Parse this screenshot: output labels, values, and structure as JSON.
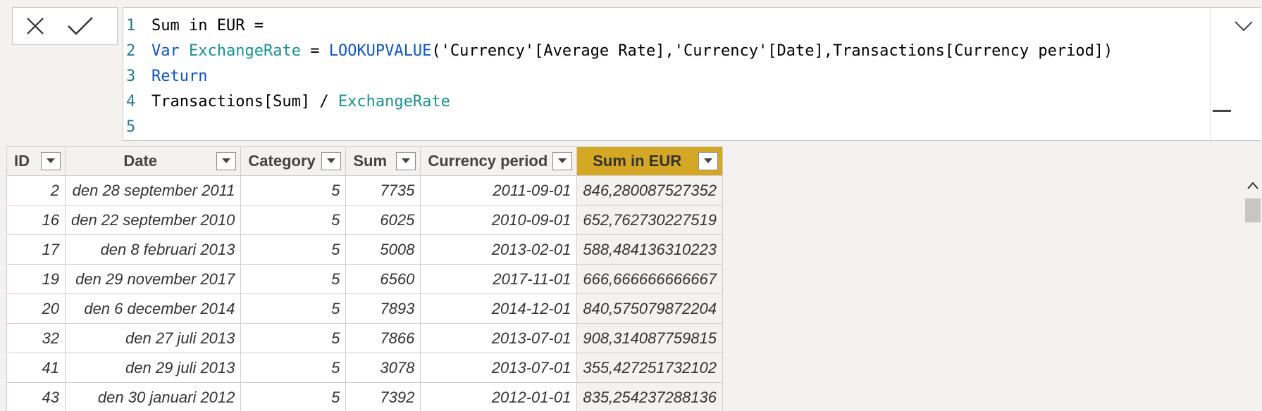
{
  "formula": {
    "cancel_icon": "close-icon",
    "commit_icon": "check-icon",
    "lines": [
      {
        "num": "1",
        "tokens": [
          {
            "t": "Sum in EUR =",
            "c": "code"
          }
        ]
      },
      {
        "num": "2",
        "tokens": [
          {
            "t": "Var",
            "c": "kw"
          },
          {
            "t": " ",
            "c": "code"
          },
          {
            "t": "ExchangeRate",
            "c": "var"
          },
          {
            "t": " = ",
            "c": "code"
          },
          {
            "t": "LOOKUPVALUE",
            "c": "fn"
          },
          {
            "t": "('Currency'[Average Rate],'Currency'[Date],Transactions[Currency period])",
            "c": "code"
          }
        ]
      },
      {
        "num": "3",
        "tokens": [
          {
            "t": "Return",
            "c": "kw"
          }
        ]
      },
      {
        "num": "4",
        "tokens": [
          {
            "t": "Transactions[Sum] / ",
            "c": "code"
          },
          {
            "t": "ExchangeRate",
            "c": "var"
          }
        ]
      },
      {
        "num": "5",
        "tokens": []
      }
    ]
  },
  "table": {
    "columns": [
      {
        "label": "ID",
        "align": "left",
        "selected": false
      },
      {
        "label": "Date",
        "align": "center",
        "selected": false
      },
      {
        "label": "Category",
        "align": "left",
        "selected": false
      },
      {
        "label": "Sum",
        "align": "left",
        "selected": false
      },
      {
        "label": "Currency period",
        "align": "left",
        "selected": false
      },
      {
        "label": "Sum in EUR",
        "align": "center",
        "selected": true
      }
    ],
    "rows": [
      [
        "2",
        "den 28 september 2011",
        "5",
        "7735",
        "2011-09-01",
        "846,280087527352"
      ],
      [
        "16",
        "den 22 september 2010",
        "5",
        "6025",
        "2010-09-01",
        "652,762730227519"
      ],
      [
        "17",
        "den 8 februari 2013",
        "5",
        "5008",
        "2013-02-01",
        "588,484136310223"
      ],
      [
        "19",
        "den 29 november 2017",
        "5",
        "6560",
        "2017-11-01",
        "666,666666666667"
      ],
      [
        "20",
        "den 6 december 2014",
        "5",
        "7893",
        "2014-12-01",
        "840,575079872204"
      ],
      [
        "32",
        "den 27 juli 2013",
        "5",
        "7866",
        "2013-07-01",
        "908,314087759815"
      ],
      [
        "41",
        "den 29 juli 2013",
        "5",
        "3078",
        "2013-07-01",
        "355,427251732102"
      ],
      [
        "43",
        "den 30 januari 2012",
        "5",
        "7392",
        "2012-01-01",
        "835,254237288136"
      ]
    ]
  },
  "colors": {
    "selected_header": "#d4a724",
    "keyword": "#0a56c2",
    "variable": "#14938f",
    "line_number": "#237893"
  }
}
